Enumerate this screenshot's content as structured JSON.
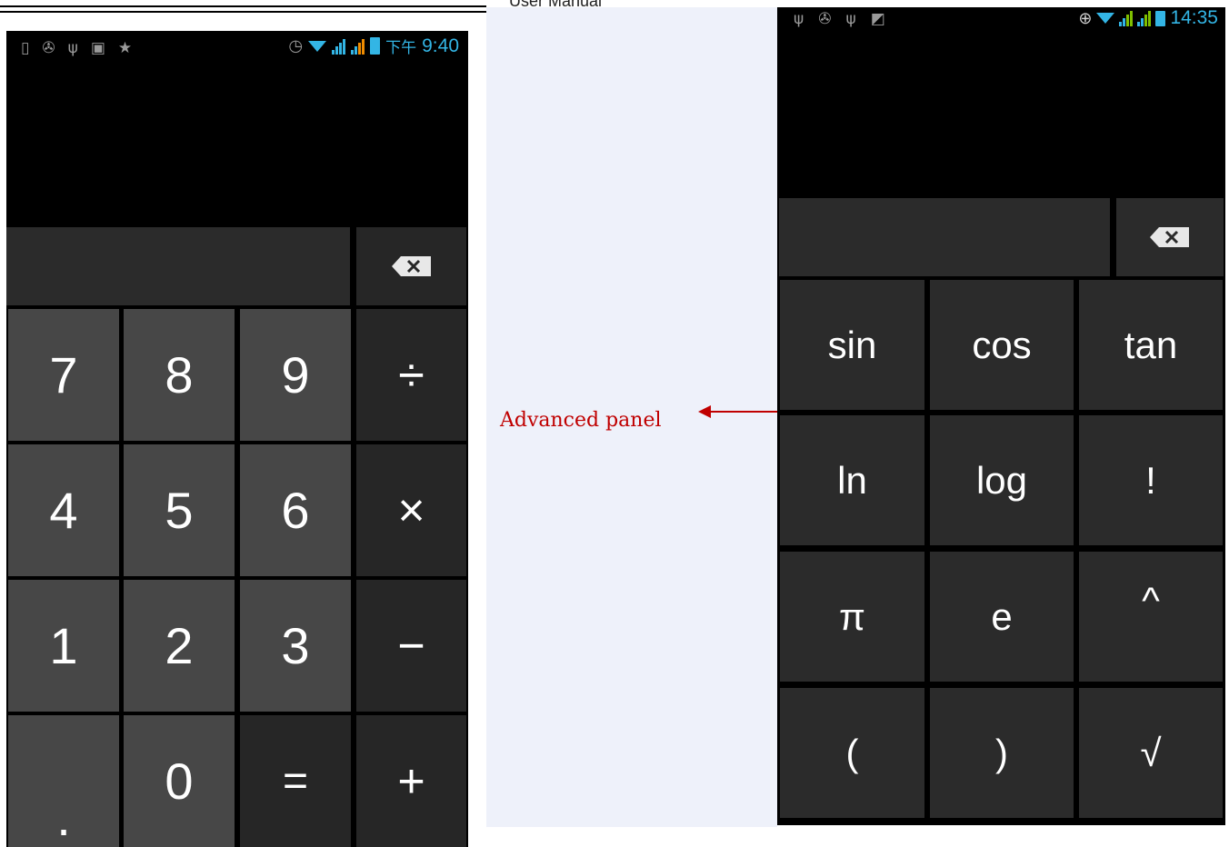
{
  "header": {
    "text": "User   Manual"
  },
  "annotation": {
    "label": "Advanced panel"
  },
  "left_phone": {
    "status_bar": {
      "left_icons": [
        "sd-card-icon",
        "android-debug-icon",
        "usb-icon",
        "message-icon",
        "star-icon"
      ],
      "time_prefix": "下午",
      "time": "9:40"
    },
    "keys": [
      {
        "label": "7",
        "kind": "digit"
      },
      {
        "label": "8",
        "kind": "digit"
      },
      {
        "label": "9",
        "kind": "digit"
      },
      {
        "label": "÷",
        "kind": "op"
      },
      {
        "label": "4",
        "kind": "digit"
      },
      {
        "label": "5",
        "kind": "digit"
      },
      {
        "label": "6",
        "kind": "digit"
      },
      {
        "label": "×",
        "kind": "op"
      },
      {
        "label": "1",
        "kind": "digit"
      },
      {
        "label": "2",
        "kind": "digit"
      },
      {
        "label": "3",
        "kind": "digit"
      },
      {
        "label": "−",
        "kind": "op"
      },
      {
        "label": ".",
        "kind": "digit"
      },
      {
        "label": "0",
        "kind": "digit"
      },
      {
        "label": "=",
        "kind": "eq"
      },
      {
        "label": "+",
        "kind": "op"
      }
    ]
  },
  "right_phone": {
    "status_bar": {
      "left_icons": [
        "usb-icon",
        "android-debug-icon",
        "usb-icon",
        "image-icon"
      ],
      "time": "14:35"
    },
    "keys": [
      {
        "label": "sin"
      },
      {
        "label": "cos"
      },
      {
        "label": "tan"
      },
      {
        "label": "ln"
      },
      {
        "label": "log"
      },
      {
        "label": "!"
      },
      {
        "label": "π"
      },
      {
        "label": "e"
      },
      {
        "label": "^"
      },
      {
        "label": "("
      },
      {
        "label": ")"
      },
      {
        "label": "√"
      }
    ]
  },
  "colors": {
    "digit_key": "#474747",
    "op_key": "#262626",
    "status_blue": "#33b5e5",
    "annotation_red": "#c00000",
    "panel_background": "#eef1fa"
  }
}
